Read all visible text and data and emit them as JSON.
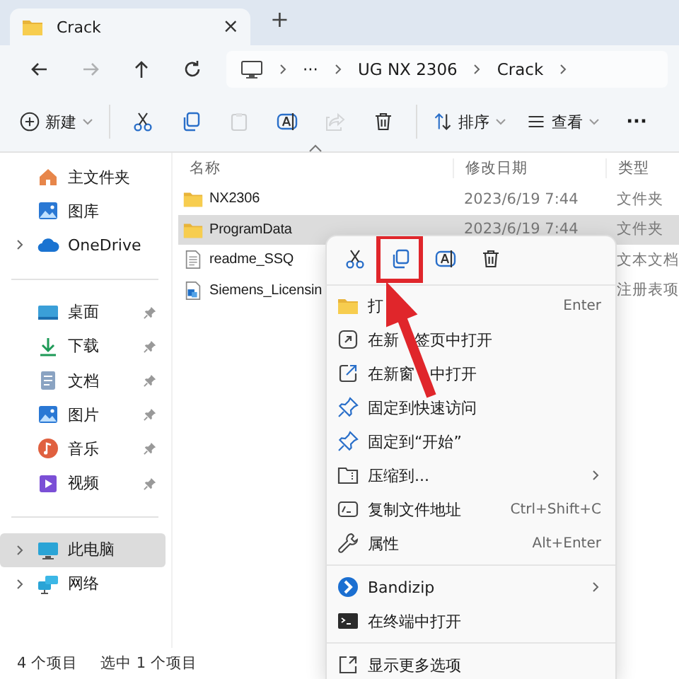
{
  "tabs": [
    {
      "title": "Crack",
      "close": "×",
      "selected": true
    }
  ],
  "new_tab": "+",
  "nav": {
    "buttons": [
      {
        "kind": "back",
        "disabled": false
      },
      {
        "kind": "forward",
        "disabled": true
      },
      {
        "kind": "up",
        "disabled": false
      },
      {
        "kind": "refresh",
        "disabled": false
      }
    ],
    "breadcrumbs": [
      "···",
      "UG NX 2306",
      "Crack"
    ]
  },
  "toolbar": {
    "new": "新建",
    "buttons": [
      {
        "kind": "cut",
        "disabled": false
      },
      {
        "kind": "copy",
        "disabled": false
      },
      {
        "kind": "paste",
        "disabled": true
      },
      {
        "kind": "rename",
        "disabled": false
      },
      {
        "kind": "share",
        "disabled": true
      },
      {
        "kind": "delete",
        "disabled": false
      }
    ],
    "sort": "排序",
    "view": "查看",
    "more": "···"
  },
  "sidebar": {
    "groups": [
      {
        "items": [
          {
            "label": "主文件夹",
            "kind": "home",
            "pinned": false,
            "expandable": false,
            "selected": false
          },
          {
            "label": "图库",
            "kind": "gallery",
            "pinned": false,
            "expandable": false,
            "selected": false
          },
          {
            "label": "OneDrive",
            "kind": "cloud",
            "pinned": false,
            "expandable": true,
            "selected": false
          }
        ]
      },
      {
        "items": [
          {
            "label": "桌面",
            "kind": "desktop",
            "pinned": true,
            "expandable": false,
            "selected": false
          },
          {
            "label": "下载",
            "kind": "download",
            "pinned": true,
            "expandable": false,
            "selected": false
          },
          {
            "label": "文档",
            "kind": "document",
            "pinned": true,
            "expandable": false,
            "selected": false
          },
          {
            "label": "图片",
            "kind": "gallery",
            "pinned": true,
            "expandable": false,
            "selected": false
          },
          {
            "label": "音乐",
            "kind": "music",
            "pinned": true,
            "expandable": false,
            "selected": false
          },
          {
            "label": "视频",
            "kind": "video",
            "pinned": true,
            "expandable": false,
            "selected": false
          }
        ]
      },
      {
        "items": [
          {
            "label": "此电脑",
            "kind": "computer",
            "pinned": false,
            "expandable": true,
            "selected": true
          },
          {
            "label": "网络",
            "kind": "network",
            "pinned": false,
            "expandable": true,
            "selected": false
          }
        ]
      }
    ]
  },
  "files": {
    "columns": [
      "名称",
      "修改日期",
      "类型"
    ],
    "rows": [
      {
        "name": "NX2306",
        "kind": "folder",
        "date": "2023/6/19 7:44",
        "type": "文件夹",
        "selected": false
      },
      {
        "name": "ProgramData",
        "kind": "folder",
        "date": "2023/6/19 7:44",
        "type": "文件夹",
        "selected": true
      },
      {
        "name": "readme_SSQ",
        "kind": "text",
        "type": "文本文档",
        "selected": false
      },
      {
        "name": "Siemens_Licensin",
        "kind": "registry",
        "type": "注册表项",
        "selected": false
      }
    ]
  },
  "status_bar": {
    "count": "4 个项目",
    "selection": "选中 1 个项目"
  },
  "context_menu": {
    "quick_actions": [
      {
        "kind": "cut",
        "highlighted": false
      },
      {
        "kind": "copy",
        "highlighted": true
      },
      {
        "kind": "rename",
        "highlighted": false
      },
      {
        "kind": "delete",
        "highlighted": false
      }
    ],
    "groups": [
      [
        {
          "label": [
            "打"
          ],
          "kind": "folder",
          "shortcut": "Enter",
          "submenu": false
        },
        {
          "label": [
            "在新",
            "签页中打开"
          ],
          "kind": "newtab",
          "submenu": false
        },
        {
          "label": [
            "在新窗",
            "中打开"
          ],
          "kind": "newwindow",
          "submenu": false
        },
        {
          "label": [
            "固定到快速访问"
          ],
          "kind": "pin",
          "submenu": false
        },
        {
          "label": [
            "固定到“开始”"
          ],
          "kind": "pin",
          "submenu": false
        },
        {
          "label": [
            "压缩到..."
          ],
          "kind": "zip",
          "submenu": true
        },
        {
          "label": [
            "复制文件地址"
          ],
          "kind": "path",
          "shortcut": "Ctrl+Shift+C",
          "submenu": false
        },
        {
          "label": [
            "属性"
          ],
          "kind": "wrench",
          "shortcut": "Alt+Enter",
          "submenu": false
        }
      ],
      [
        {
          "label": [
            "Bandizip"
          ],
          "kind": "bandizip",
          "submenu": true
        },
        {
          "label": [
            "在终端中打开"
          ],
          "kind": "terminal",
          "submenu": false
        }
      ],
      [
        {
          "label": [
            "显示更多选项"
          ],
          "kind": "more",
          "submenu": false
        }
      ]
    ]
  }
}
